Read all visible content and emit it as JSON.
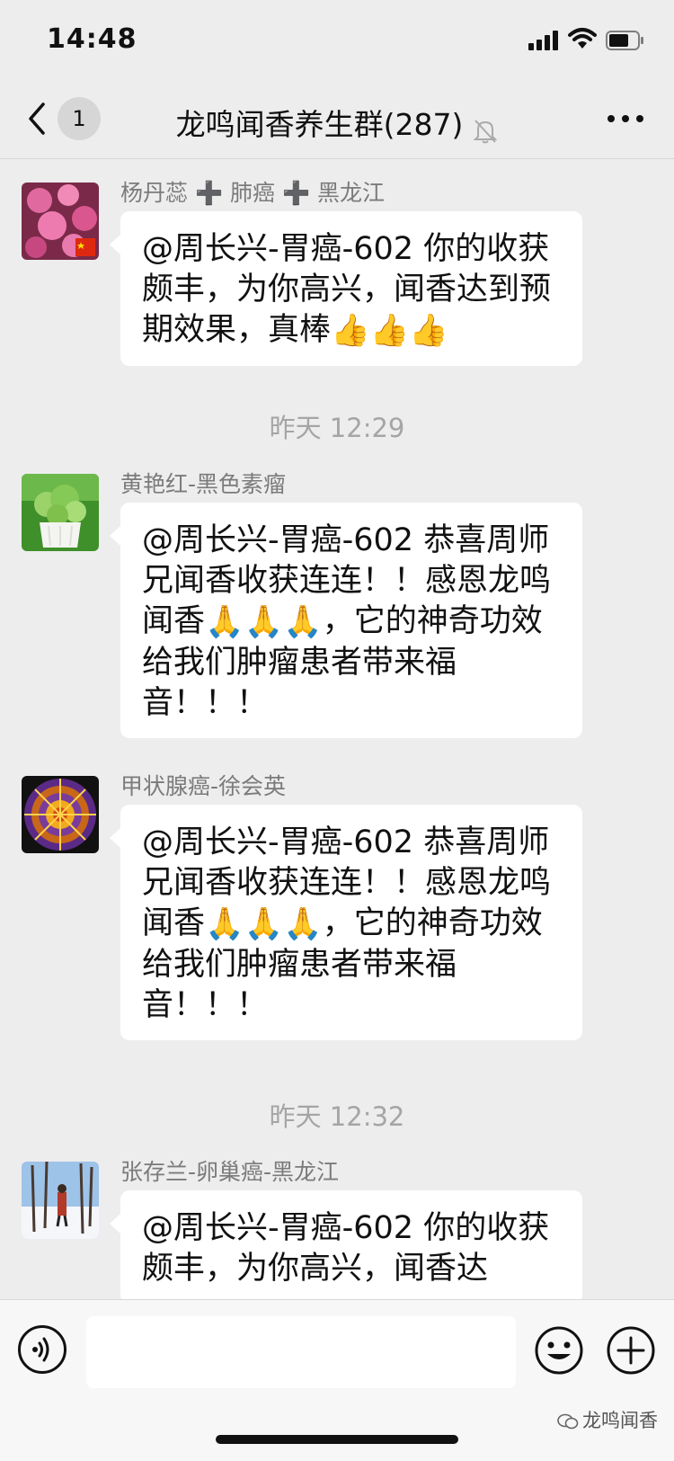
{
  "status_bar": {
    "time": "14:48"
  },
  "nav": {
    "unread_count": "1",
    "title": "龙鸣闻香养生群(287)"
  },
  "messages": [
    {
      "sender": "杨丹蕊 ➕ 肺癌 ➕ 黑龙江",
      "text_main": "@周长兴-胃癌-602 你的收获颇丰，为你高兴，闻香达到预期效果，真棒",
      "emoji": "👍👍👍"
    },
    {
      "timestamp": "昨天 12:29"
    },
    {
      "sender": "黄艳红-黑色素瘤",
      "text_before": "@周长兴-胃癌-602 恭喜周师兄闻香收获连连！！感恩龙鸣闻香",
      "emoji": "🙏🙏🙏",
      "text_after": "，它的神奇功效给我们肿瘤患者带来福音！！！"
    },
    {
      "sender": "甲状腺癌-徐会英",
      "text_before": "@周长兴-胃癌-602 恭喜周师兄闻香收获连连！！感恩龙鸣闻香",
      "emoji": "🙏🙏🙏",
      "text_after": "，它的神奇功效给我们肿瘤患者带来福音！！！"
    },
    {
      "timestamp": "昨天 12:32"
    },
    {
      "sender": "张存兰-卵巢癌-黑龙江",
      "text_main": "@周长兴-胃癌-602 你的收获颇丰，为你高兴，闻香达"
    }
  ],
  "watermark": "龙鸣闻香"
}
